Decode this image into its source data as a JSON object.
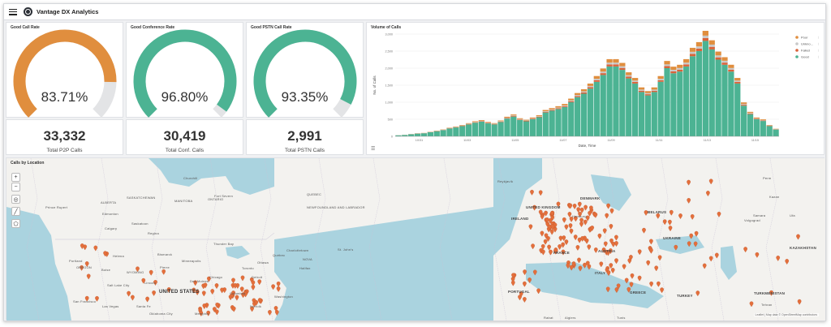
{
  "header": {
    "title": "Vantage DX Analytics"
  },
  "gauges": [
    {
      "title": "Good Call Rate",
      "value_text": "83.71%",
      "fraction": 0.8371,
      "color": "#e08e3e"
    },
    {
      "title": "Good Conference Rate",
      "value_text": "96.80%",
      "fraction": 0.968,
      "color": "#4cb393"
    },
    {
      "title": "Good PSTN Call Rate",
      "value_text": "93.35%",
      "fraction": 0.9335,
      "color": "#4cb393"
    }
  ],
  "metrics": [
    {
      "value": "33,332",
      "label": "Total P2P Calls"
    },
    {
      "value": "30,419",
      "label": "Total Conf. Calls"
    },
    {
      "value": "2,991",
      "label": "Total PSTN Calls"
    }
  ],
  "chart": {
    "title": "Volume of Calls"
  },
  "chart_data": {
    "type": "bar",
    "stacked": true,
    "title": "Volume of Calls",
    "xlabel": "Date, Time",
    "ylabel": "No. of Calls",
    "ylim": [
      0,
      3000
    ],
    "yticks": [
      0,
      500,
      1000,
      1500,
      2000,
      2500,
      3000
    ],
    "yticklabels": [
      "0",
      "500",
      "1,000",
      "1,500",
      "2,000",
      "2,500",
      "3,000"
    ],
    "xticklabels": [
      "10/31",
      "11/03",
      "11/05",
      "11/07",
      "11/09",
      "11/11",
      "11/13",
      "11/15"
    ],
    "colors": {
      "Poor": "#e08e3e",
      "Unknown": "#c8c8c8",
      "Failed": "#d9633a",
      "Good": "#4cb393"
    },
    "legend": [
      "Poor",
      "Unkno...",
      "Failed",
      "Good"
    ],
    "legend_placement": "top-right",
    "series": [
      {
        "name": "Good",
        "values": [
          30,
          40,
          60,
          80,
          90,
          120,
          150,
          180,
          230,
          260,
          300,
          350,
          400,
          430,
          380,
          350,
          420,
          520,
          580,
          480,
          440,
          500,
          560,
          700,
          750,
          800,
          860,
          1000,
          1150,
          1250,
          1400,
          1600,
          1800,
          2050,
          2050,
          1950,
          1700,
          1550,
          1300,
          1200,
          1300,
          1600,
          2000,
          1850,
          1900,
          2050,
          2350,
          2500,
          2800,
          2550,
          2250,
          2100,
          1900,
          1550,
          900,
          650,
          500,
          450,
          300,
          200
        ]
      },
      {
        "name": "Failed",
        "values": [
          1,
          1,
          2,
          3,
          3,
          4,
          5,
          6,
          7,
          8,
          9,
          10,
          12,
          13,
          12,
          11,
          13,
          15,
          17,
          14,
          13,
          15,
          17,
          20,
          22,
          24,
          25,
          30,
          34,
          37,
          42,
          48,
          54,
          60,
          60,
          57,
          50,
          46,
          38,
          36,
          38,
          47,
          60,
          55,
          56,
          60,
          70,
          75,
          84,
          76,
          67,
          63,
          57,
          46,
          27,
          19,
          15,
          13,
          9,
          6
        ]
      },
      {
        "name": "Unknown",
        "values": [
          1,
          1,
          2,
          2,
          3,
          4,
          4,
          5,
          6,
          7,
          8,
          9,
          10,
          11,
          10,
          9,
          11,
          13,
          15,
          12,
          11,
          13,
          14,
          18,
          19,
          20,
          22,
          26,
          29,
          32,
          36,
          41,
          46,
          52,
          52,
          50,
          43,
          40,
          33,
          31,
          33,
          41,
          51,
          47,
          48,
          52,
          60,
          64,
          71,
          65,
          57,
          54,
          48,
          40,
          23,
          17,
          13,
          12,
          8,
          5
        ]
      },
      {
        "name": "Poor",
        "values": [
          1,
          2,
          3,
          4,
          4,
          6,
          7,
          9,
          11,
          13,
          15,
          17,
          20,
          21,
          19,
          17,
          21,
          26,
          29,
          24,
          22,
          25,
          28,
          35,
          37,
          40,
          43,
          50,
          57,
          62,
          70,
          80,
          90,
          102,
          102,
          97,
          85,
          77,
          65,
          60,
          65,
          80,
          100,
          92,
          95,
          102,
          117,
          125,
          140,
          127,
          112,
          105,
          95,
          77,
          45,
          32,
          25,
          22,
          15,
          10
        ]
      }
    ]
  },
  "map": {
    "title": "Calls by Location",
    "attribution": "Leaflet | Map data © OpenStreetMap contributors",
    "marker_color": "#e46f3b",
    "labels": [
      {
        "text": "Churchill",
        "kind": "city"
      },
      {
        "text": "Prince Rupert",
        "kind": "city"
      },
      {
        "text": "ALBERTA",
        "kind": "region"
      },
      {
        "text": "SASKATCHEWAN",
        "kind": "region"
      },
      {
        "text": "MANITOBA",
        "kind": "region"
      },
      {
        "text": "ONTARIO",
        "kind": "region"
      },
      {
        "text": "QUEBEC",
        "kind": "region"
      },
      {
        "text": "NEWFOUNDLAND AND LABRADOR",
        "kind": "region"
      },
      {
        "text": "NOVA",
        "kind": "region"
      },
      {
        "text": "Fort Severn",
        "kind": "city"
      },
      {
        "text": "Edmonton",
        "kind": "city"
      },
      {
        "text": "Saskatoon",
        "kind": "city"
      },
      {
        "text": "Calgary",
        "kind": "city"
      },
      {
        "text": "Regina",
        "kind": "city"
      },
      {
        "text": "Thunder Bay",
        "kind": "city"
      },
      {
        "text": "Bismarck",
        "kind": "city"
      },
      {
        "text": "Helena",
        "kind": "city"
      },
      {
        "text": "Portland",
        "kind": "city"
      },
      {
        "text": "Boise",
        "kind": "city"
      },
      {
        "text": "OREGON",
        "kind": "region"
      },
      {
        "text": "WYOMING",
        "kind": "region"
      },
      {
        "text": "Pierre",
        "kind": "city"
      },
      {
        "text": "Minneapolis",
        "kind": "city"
      },
      {
        "text": "Salt Lake City",
        "kind": "city"
      },
      {
        "text": "Lincoln",
        "kind": "city"
      },
      {
        "text": "Des Moines",
        "kind": "city"
      },
      {
        "text": "UNITED STATES",
        "kind": "country-big"
      },
      {
        "text": "San Francisco",
        "kind": "city"
      },
      {
        "text": "Las Vegas",
        "kind": "city"
      },
      {
        "text": "Santa Fe",
        "kind": "city"
      },
      {
        "text": "Oklahoma City",
        "kind": "city"
      },
      {
        "text": "Memphis",
        "kind": "city"
      },
      {
        "text": "Chicago",
        "kind": "city"
      },
      {
        "text": "Detroit",
        "kind": "city"
      },
      {
        "text": "Toronto",
        "kind": "city"
      },
      {
        "text": "Ottawa",
        "kind": "city"
      },
      {
        "text": "Québec",
        "kind": "city"
      },
      {
        "text": "Charlottetown",
        "kind": "city"
      },
      {
        "text": "Halifax",
        "kind": "city"
      },
      {
        "text": "St. John's",
        "kind": "city"
      },
      {
        "text": "Washington",
        "kind": "city"
      },
      {
        "text": "Norfolk",
        "kind": "city"
      },
      {
        "text": "Columbus",
        "kind": "city"
      },
      {
        "text": "Reykjavík",
        "kind": "city"
      },
      {
        "text": "IRELAND",
        "kind": "country"
      },
      {
        "text": "UNITED KINGDOM",
        "kind": "country"
      },
      {
        "text": "DENMARK",
        "kind": "country"
      },
      {
        "text": "Hamburg",
        "kind": "city"
      },
      {
        "text": "BELARUS",
        "kind": "country"
      },
      {
        "text": "FRANCE",
        "kind": "country"
      },
      {
        "text": "AUSTRIA",
        "kind": "country"
      },
      {
        "text": "UKRAINE",
        "kind": "country"
      },
      {
        "text": "ITALY",
        "kind": "country"
      },
      {
        "text": "PORTUGAL",
        "kind": "country"
      },
      {
        "text": "GREECE",
        "kind": "country"
      },
      {
        "text": "TURKEY",
        "kind": "country"
      },
      {
        "text": "Algiers",
        "kind": "city"
      },
      {
        "text": "Rabat",
        "kind": "city"
      },
      {
        "text": "Tunis",
        "kind": "city"
      },
      {
        "text": "KAZAKHSTAN",
        "kind": "country"
      },
      {
        "text": "TURKMENISTAN",
        "kind": "country"
      },
      {
        "text": "Volgograd",
        "kind": "city"
      },
      {
        "text": "Perm",
        "kind": "city"
      },
      {
        "text": "Kazan",
        "kind": "city"
      },
      {
        "text": "Samara",
        "kind": "city"
      },
      {
        "text": "Ufa",
        "kind": "city"
      },
      {
        "text": "Tehran",
        "kind": "city"
      }
    ],
    "controls": [
      {
        "name": "zoom-in-button",
        "glyph": "+"
      },
      {
        "name": "zoom-out-button",
        "glyph": "−"
      },
      {
        "name": "locate-button",
        "glyph": "◎"
      },
      {
        "name": "draw-line-button",
        "glyph": "╱"
      },
      {
        "name": "draw-shape-button",
        "glyph": "⬠"
      }
    ]
  }
}
